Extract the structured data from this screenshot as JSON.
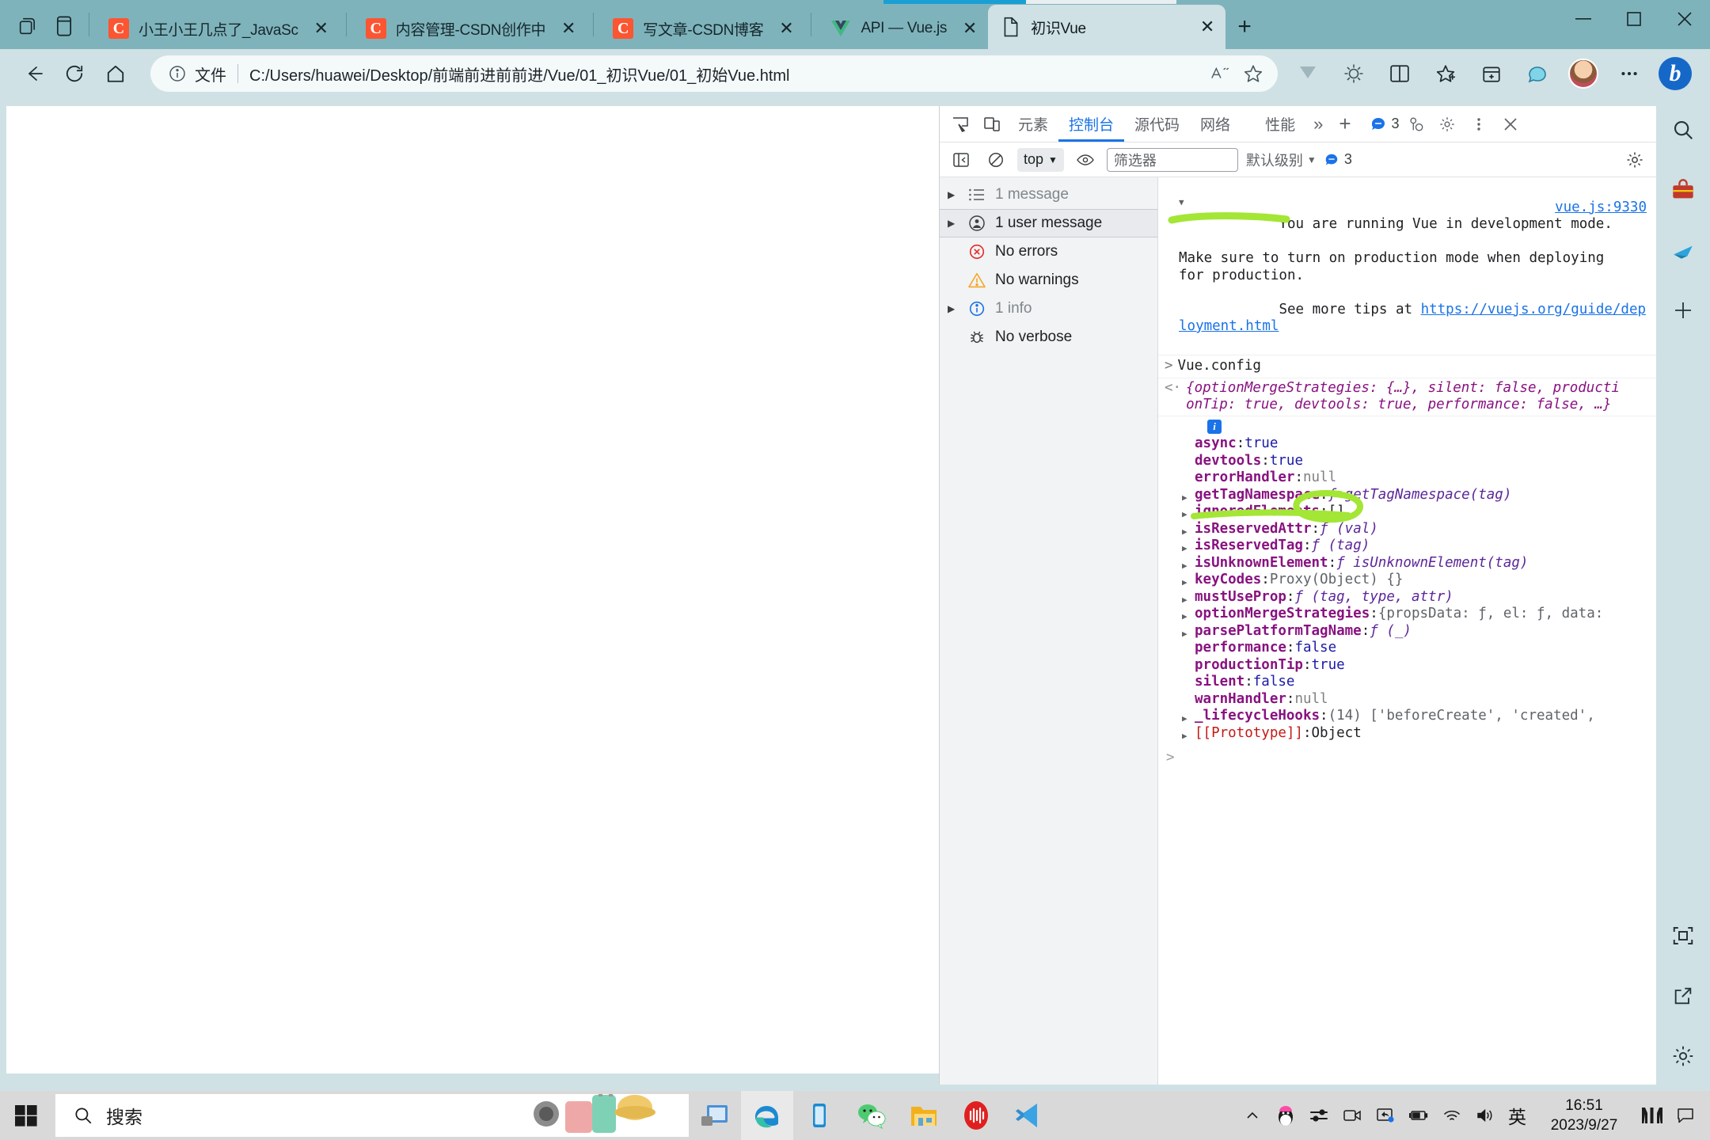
{
  "browser": {
    "tabs": [
      {
        "title": "小王小王几点了_JavaSc",
        "favicon": "csdn-icon",
        "active": false,
        "closable": true
      },
      {
        "title": "内容管理-CSDN创作中",
        "favicon": "csdn-icon",
        "active": false,
        "closable": true
      },
      {
        "title": "写文章-CSDN博客",
        "favicon": "csdn-icon",
        "active": false,
        "closable": true
      },
      {
        "title": "API — Vue.js",
        "favicon": "vue-icon",
        "active": false,
        "closable": true
      },
      {
        "title": "初识Vue",
        "favicon": "document-icon",
        "active": true,
        "closable": true
      }
    ],
    "tab_strip_icons": [
      "tab-actions-icon",
      "tab-list-icon"
    ],
    "new_tab_label": "+",
    "window_controls": [
      "minimize",
      "maximize",
      "close"
    ],
    "toolbar": {
      "back_label": "←",
      "refresh_label": "⟳",
      "home_label": "⌂",
      "scheme_label": "文件",
      "url": "C:/Users/huawei/Desktop/前端前进前前进/Vue/01_初识Vue/01_初始Vue.html",
      "read_aloud_label": "A",
      "favorite_label": "☆",
      "right_icons": [
        "collections-icon",
        "browser-essentials-icon",
        "split-screen-icon",
        "favorites-icon",
        "collections-bin-icon",
        "copilot-icon",
        "profile-avatar",
        "settings-more-icon",
        "bing-icon"
      ]
    },
    "right_rail_icons": [
      "search-icon",
      "shopping-icon",
      "games-icon",
      "add-icon",
      "screenshot-icon",
      "open-window-icon",
      "settings-icon"
    ]
  },
  "devtools": {
    "tabs": [
      {
        "label": "元素",
        "selected": false
      },
      {
        "label": "控制台",
        "selected": true
      },
      {
        "label": "源代码",
        "selected": false
      },
      {
        "label": "网络",
        "selected": false
      },
      {
        "label": "性能",
        "selected": false
      }
    ],
    "overflow_label": "»",
    "add_panel_label": "+",
    "issues_count": "3",
    "top_icons": [
      "inspect-element-icon",
      "device-toolbar-icon"
    ],
    "right_icons": [
      "devtools-settings-icon",
      "more-options-icon",
      "close-devtools-icon",
      "issues-icon"
    ],
    "filters": {
      "sidebar_toggle_label": "⊟",
      "clear_console_label": "⊘",
      "context_selector": "top",
      "live_expression_label": "eye-icon",
      "filter_placeholder": "筛选器",
      "level_selector": "默认级别",
      "issue_count": "3",
      "settings_label": "gear-icon"
    },
    "sidebar": [
      {
        "label": "1 message",
        "icon": "list-icon",
        "expandable": true,
        "muted": true,
        "selected": false
      },
      {
        "label": "1 user message",
        "icon": "user-icon",
        "expandable": true,
        "muted": false,
        "selected": true
      },
      {
        "label": "No errors",
        "icon": "error-icon",
        "expandable": false,
        "muted": false,
        "selected": false
      },
      {
        "label": "No warnings",
        "icon": "warning-icon",
        "expandable": false,
        "muted": false,
        "selected": false
      },
      {
        "label": "1 info",
        "icon": "info-icon",
        "expandable": true,
        "muted": true,
        "selected": false
      },
      {
        "label": "No verbose",
        "icon": "bug-icon",
        "expandable": false,
        "muted": false,
        "selected": false
      }
    ],
    "console": {
      "info_message": {
        "line1": "You are running Vue in development mode.",
        "source": "vue.js:9330",
        "line2": "Make sure to turn on production mode when deploying",
        "line3": "for production.",
        "line4_prefix": "See more tips at ",
        "line4_link": "https://vuejs.org/guide/deployment.html"
      },
      "input_expression": "Vue.config",
      "result_preview_part1": "{optionMergeStrategies: {…}, silent: false, producti",
      "result_preview_part2": "onTip: true, devtools: true, performance: false, …}",
      "properties": [
        {
          "name": "async",
          "sep": ": ",
          "value": "true",
          "vtype": "bool",
          "expandable": false
        },
        {
          "name": "devtools",
          "sep": ": ",
          "value": "true",
          "vtype": "bool",
          "expandable": false
        },
        {
          "name": "errorHandler",
          "sep": ": ",
          "value": "null",
          "vtype": "null",
          "expandable": false
        },
        {
          "name": "getTagNamespace",
          "sep": ": ",
          "value": "ƒ getTagNamespace(tag)",
          "vtype": "fn",
          "expandable": true
        },
        {
          "name": "ignoredElements",
          "sep": ": ",
          "value": "[]",
          "vtype": "obj",
          "expandable": true
        },
        {
          "name": "isReservedAttr",
          "sep": ": ",
          "value": "ƒ (val)",
          "vtype": "fn",
          "expandable": true
        },
        {
          "name": "isReservedTag",
          "sep": ": ",
          "value": "ƒ (tag)",
          "vtype": "fn",
          "expandable": true
        },
        {
          "name": "isUnknownElement",
          "sep": ": ",
          "value": "ƒ isUnknownElement(tag)",
          "vtype": "fn",
          "expandable": true
        },
        {
          "name": "keyCodes",
          "sep": ": ",
          "value": "Proxy(Object) {}",
          "vtype": "gray",
          "expandable": true
        },
        {
          "name": "mustUseProp",
          "sep": ": ",
          "value": "ƒ (tag, type, attr)",
          "vtype": "fn",
          "expandable": true
        },
        {
          "name": "optionMergeStrategies",
          "sep": ": ",
          "value": "{propsData: ƒ, el: ƒ, data:",
          "vtype": "objpreview",
          "expandable": true
        },
        {
          "name": "parsePlatformTagName",
          "sep": ": ",
          "value": "ƒ (_)",
          "vtype": "fn",
          "expandable": true
        },
        {
          "name": "performance",
          "sep": ": ",
          "value": "false",
          "vtype": "bool",
          "expandable": false
        },
        {
          "name": "productionTip",
          "sep": ": ",
          "value": "true",
          "vtype": "bool",
          "expandable": false,
          "highlighted": true
        },
        {
          "name": "silent",
          "sep": ": ",
          "value": "false",
          "vtype": "bool",
          "expandable": false
        },
        {
          "name": "warnHandler",
          "sep": ": ",
          "value": "null",
          "vtype": "null",
          "expandable": false
        },
        {
          "name": "_lifecycleHooks",
          "sep": ": ",
          "value": "(14) ['beforeCreate', 'created',",
          "vtype": "arrpreview",
          "expandable": true
        },
        {
          "name": "[[Prototype]]",
          "sep": ": ",
          "value": "Object",
          "vtype": "obj",
          "expandable": true,
          "proto": true
        }
      ],
      "next_prompt": ">"
    },
    "annotations": {
      "color": "#a3e635",
      "marks": [
        "underline-vue-config",
        "circle-productiontip-true",
        "underline-productiontip"
      ]
    }
  },
  "taskbar": {
    "start_label": "start-icon",
    "search_placeholder": "搜索",
    "apps": [
      {
        "name": "widget-news-icon",
        "active": false
      },
      {
        "name": "microsoft-edge-icon",
        "active": true
      },
      {
        "name": "phone-link-icon",
        "active": false
      },
      {
        "name": "wechat-icon",
        "active": false
      },
      {
        "name": "file-explorer-icon",
        "active": false
      },
      {
        "name": "netease-music-icon",
        "active": false
      },
      {
        "name": "vscode-icon",
        "active": false
      }
    ],
    "tray_icons": [
      "show-hidden-icons-chevron",
      "qq-icon",
      "settings-sliders-icon",
      "camera-icon",
      "share-screen-icon",
      "battery-icon",
      "wifi-icon",
      "volume-icon"
    ],
    "ime_label": "英",
    "clock_time": "16:51",
    "clock_date": "2023/9/27",
    "right_icons": [
      "msi-center-icon",
      "notification-icon"
    ]
  }
}
